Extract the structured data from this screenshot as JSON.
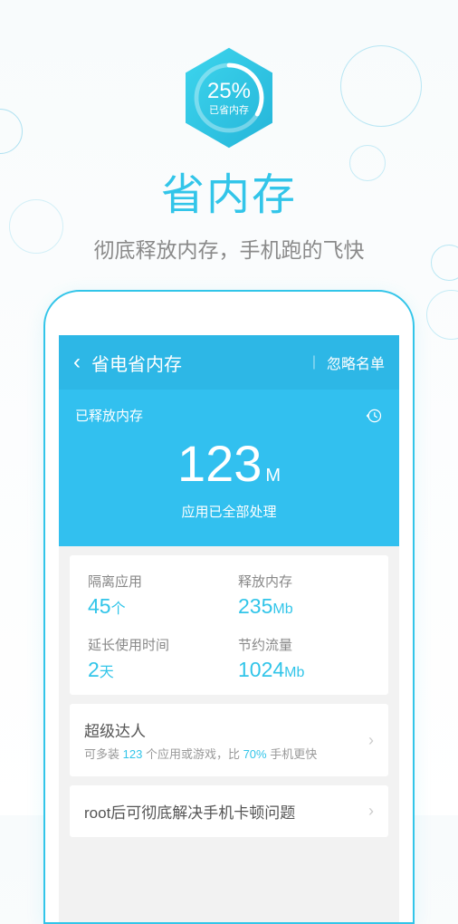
{
  "badge": {
    "percent": "25%",
    "label": "已省内存"
  },
  "title": "省内存",
  "subtitle": "彻底释放内存，手机跑的飞快",
  "header": {
    "title": "省电省内存",
    "right": "忽略名单"
  },
  "memory": {
    "released_label": "已释放内存",
    "value": "123",
    "unit": "M",
    "processed": "应用已全部处理"
  },
  "stats": [
    {
      "label": "隔离应用",
      "value": "45",
      "unit": "个"
    },
    {
      "label": "释放内存",
      "value": "235",
      "unit": "Mb"
    },
    {
      "label": "延长使用时间",
      "value": "2",
      "unit": "天"
    },
    {
      "label": "节约流量",
      "value": "1024",
      "unit": "Mb"
    }
  ],
  "promo": {
    "title": "超级达人",
    "pre": "可多装 ",
    "n1": "123",
    "mid": " 个应用或游戏，比 ",
    "n2": "70%",
    "post": " 手机更快"
  },
  "root_msg": "root后可彻底解决手机卡顿问题"
}
